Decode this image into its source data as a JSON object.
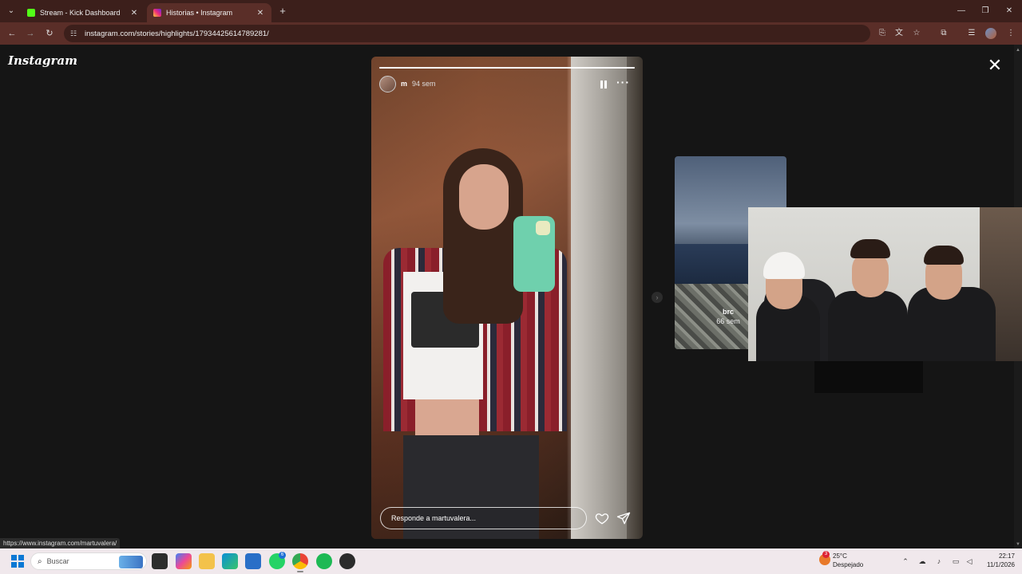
{
  "browser": {
    "tabs": [
      {
        "title": "Stream - Kick Dashboard",
        "favicon_color": "#53fc18",
        "active": false
      },
      {
        "title": "Historias • Instagram",
        "favicon_color": "#d6249f",
        "active": true
      }
    ],
    "url": "instagram.com/stories/highlights/17934425614789281/",
    "status_url": "https://www.instagram.com/martuvalera/"
  },
  "page": {
    "logo": "Instagram",
    "story": {
      "username": "m",
      "time_ago": "94 sem",
      "progress": 1.0,
      "reply_placeholder": "Responde a martuvalera..."
    },
    "next_story": {
      "username": "brc",
      "time_ago": "66 sem"
    }
  },
  "taskbar": {
    "search_placeholder": "Buscar",
    "weather": {
      "temp": "25°C",
      "condition": "Despejado",
      "badge": "3"
    },
    "time": "22:17",
    "date": "11/1/2026",
    "whatsapp_badge": "6"
  }
}
